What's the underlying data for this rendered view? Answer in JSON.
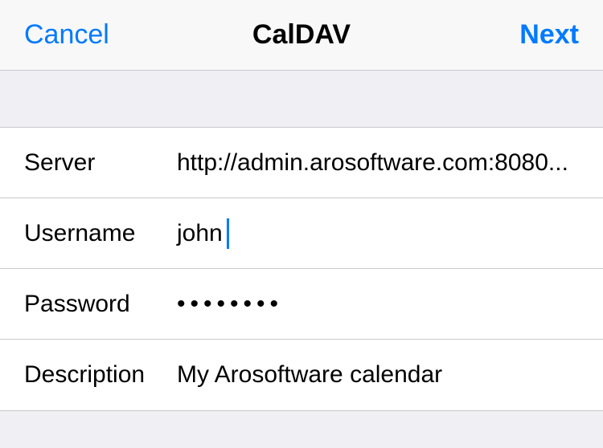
{
  "header": {
    "cancel_label": "Cancel",
    "title": "CalDAV",
    "next_label": "Next"
  },
  "form": {
    "server": {
      "label": "Server",
      "value": "http://admin.arosoftware.com:8080..."
    },
    "username": {
      "label": "Username",
      "value": "john"
    },
    "password": {
      "label": "Password",
      "value": "••••••••"
    },
    "description": {
      "label": "Description",
      "value": "My Arosoftware calendar"
    }
  }
}
